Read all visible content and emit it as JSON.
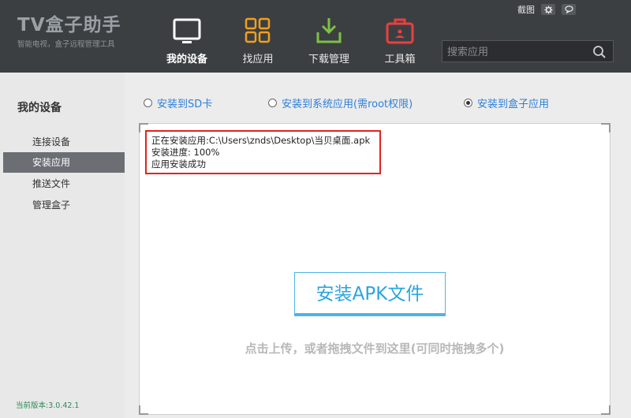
{
  "logo": {
    "title": "TV盒子助手",
    "subtitle": "智能电视，盒子远程管理工具"
  },
  "nav": [
    {
      "label": "我的设备",
      "icon": "tv-icon",
      "active": true
    },
    {
      "label": "找应用",
      "icon": "apps-grid-icon",
      "active": false
    },
    {
      "label": "下载管理",
      "icon": "download-icon",
      "active": false
    },
    {
      "label": "工具箱",
      "icon": "toolbox-icon",
      "active": false
    }
  ],
  "top_links": {
    "screenshot": "截图",
    "settings_icon": "gear-icon",
    "feedback_icon": "chat-icon"
  },
  "search": {
    "placeholder": "搜索应用",
    "icon": "search-icon"
  },
  "sidebar": {
    "title": "我的设备",
    "items": [
      {
        "label": "连接设备",
        "active": false
      },
      {
        "label": "安装应用",
        "active": true
      },
      {
        "label": "推送文件",
        "active": false
      },
      {
        "label": "管理盒子",
        "active": false
      }
    ],
    "version": "当前版本:3.0.42.1"
  },
  "install_options": [
    {
      "label": "安装到SD卡",
      "checked": false
    },
    {
      "label": "安装到系统应用(需root权限)",
      "checked": false
    },
    {
      "label": "安装到盒子应用",
      "checked": true
    }
  ],
  "status": {
    "line1": "正在安装应用:C:\\Users\\znds\\Desktop\\当贝桌面.apk",
    "line2": "安装进度:  100%",
    "line3": "应用安装成功"
  },
  "install_button": "安装APK文件",
  "hint": "点击上传，或者拖拽文件到这里(可同时拖拽多个)",
  "colors": {
    "accent": "#2aa5df",
    "header_bg": "#3c3f42",
    "highlight_red": "#e0231f"
  }
}
